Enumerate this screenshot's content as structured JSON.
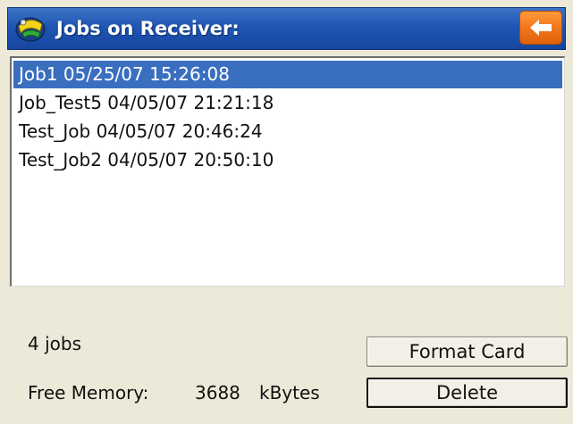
{
  "window": {
    "title": "Jobs on Receiver:",
    "app_icon": "receiver-app-icon",
    "back_icon": "back-arrow-icon"
  },
  "jobs": [
    {
      "label": "Job1 05/25/07 15:26:08",
      "selected": true
    },
    {
      "label": "Job_Test5 04/05/07 21:21:18",
      "selected": false
    },
    {
      "label": "Test_Job 04/05/07 20:46:24",
      "selected": false
    },
    {
      "label": "Test_Job2 04/05/07 20:50:10",
      "selected": false
    }
  ],
  "status": {
    "job_count": "4 jobs",
    "free_memory_label": "Free Memory:",
    "free_memory_value": "3688",
    "free_memory_unit": "kBytes"
  },
  "buttons": {
    "format_card": "Format Card",
    "delete": "Delete"
  },
  "colors": {
    "title_bar": "#1f55b3",
    "back_button": "#f0741a",
    "selection": "#3a6fc0",
    "background": "#ece9d8"
  }
}
